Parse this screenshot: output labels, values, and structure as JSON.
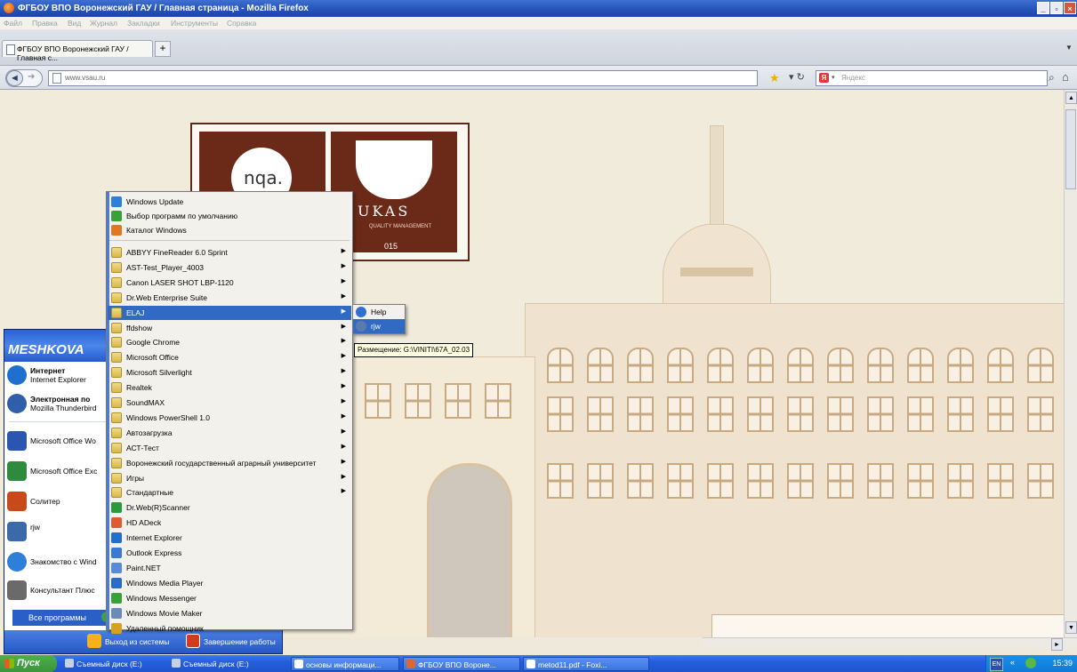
{
  "window": {
    "title": "ФГБОУ ВПО Воронежский ГАУ / Главная страница - Mozilla Firefox",
    "minimize": "_",
    "maximize": "▫",
    "close": "×"
  },
  "menubar": [
    "Файл",
    "Правка",
    "Вид",
    "Журнал",
    "Закладки",
    "Инструменты",
    "Справка"
  ],
  "tabs": [
    {
      "label": "ФГБОУ ВПО Воронежский ГАУ / Главная с..."
    }
  ],
  "new_tab": "+",
  "navbar": {
    "url": "www.vsau.ru",
    "search_placeholder": "Яндекс",
    "search_engine": "Я"
  },
  "logos": {
    "nqa": "nqa.",
    "ukas": "UKAS",
    "ukas_sub": "QUALITY MANAGEMENT",
    "ukas_number": "015"
  },
  "start_menu": {
    "user": "MESHKOVA",
    "pinned": [
      {
        "title": "Интернет",
        "subtitle": "Internet Explorer",
        "icon": "internet-explorer-icon",
        "color": "#1e6fd0"
      },
      {
        "title": "Электронная по",
        "subtitle": "Mozilla Thunderbird",
        "icon": "thunderbird-icon",
        "color": "#2f5fa8"
      }
    ],
    "recent": [
      {
        "label": "Microsoft Office Wo",
        "icon": "word-icon",
        "color": "#2a55b0"
      },
      {
        "label": "Microsoft Office Exc",
        "icon": "excel-icon",
        "color": "#2e8b3e"
      },
      {
        "label": "Солитер",
        "icon": "solitaire-icon",
        "color": "#c84a1a"
      },
      {
        "label": "rjw",
        "icon": "rjw-icon",
        "color": "#3b6aa8"
      },
      {
        "label": "Знакомство с Wind",
        "icon": "windows-tour-icon",
        "color": "#2e7fd8"
      },
      {
        "label": "Консультант Плюс",
        "icon": "consultant-icon",
        "color": "#6a6a6a"
      }
    ],
    "all_programs": "Все программы",
    "log_off": "Выход из системы",
    "shut_down": "Завершение работы"
  },
  "programs_menu": {
    "top": [
      {
        "label": "Windows Update",
        "icon": "windows-update-icon",
        "color": "#2e7fd8"
      },
      {
        "label": "Выбор программ по умолчанию",
        "icon": "default-programs-icon",
        "color": "#3aa03a"
      },
      {
        "label": "Каталог Windows",
        "icon": "windows-catalog-icon",
        "color": "#e07820"
      }
    ],
    "items": [
      {
        "label": "ABBYY FineReader 6.0 Sprint",
        "folder": true,
        "arrow": true
      },
      {
        "label": "AST-Test_Player_4003",
        "folder": true,
        "arrow": true
      },
      {
        "label": "Canon LASER SHOT LBP-1120",
        "folder": true,
        "arrow": true
      },
      {
        "label": "Dr.Web Enterprise Suite",
        "folder": true,
        "arrow": true
      },
      {
        "label": "ELAJ",
        "folder": true,
        "arrow": true,
        "highlight": true
      },
      {
        "label": "ffdshow",
        "folder": true,
        "arrow": true
      },
      {
        "label": "Google Chrome",
        "folder": true,
        "arrow": true
      },
      {
        "label": "Microsoft Office",
        "folder": true,
        "arrow": true
      },
      {
        "label": "Microsoft Silverlight",
        "folder": true,
        "arrow": true
      },
      {
        "label": "Realtek",
        "folder": true,
        "arrow": true
      },
      {
        "label": "SoundMAX",
        "folder": true,
        "arrow": true
      },
      {
        "label": "Windows PowerShell 1.0",
        "folder": true,
        "arrow": true
      },
      {
        "label": "Автозагрузка",
        "folder": true,
        "arrow": true
      },
      {
        "label": "АСТ-Тест",
        "folder": true,
        "arrow": true
      },
      {
        "label": "Воронежский государственный аграрный университет",
        "folder": true,
        "arrow": true
      },
      {
        "label": "Игры",
        "folder": true,
        "arrow": true
      },
      {
        "label": "Стандартные",
        "folder": true,
        "arrow": true
      },
      {
        "label": "Dr.Web(R)Scanner",
        "folder": false,
        "arrow": false,
        "color": "#2a9a3a"
      },
      {
        "label": "HD ADeck",
        "folder": false,
        "arrow": false,
        "color": "#e05a30"
      },
      {
        "label": "Internet Explorer",
        "folder": false,
        "arrow": false,
        "color": "#1e6fd0"
      },
      {
        "label": "Outlook Express",
        "folder": false,
        "arrow": false,
        "color": "#3a7ad0"
      },
      {
        "label": "Paint.NET",
        "folder": false,
        "arrow": false,
        "color": "#5a8ad8"
      },
      {
        "label": "Windows Media Player",
        "folder": false,
        "arrow": false,
        "color": "#2a6ac8"
      },
      {
        "label": "Windows Messenger",
        "folder": false,
        "arrow": false,
        "color": "#3aa03a"
      },
      {
        "label": "Windows Movie Maker",
        "folder": false,
        "arrow": false,
        "color": "#6a8ab8"
      },
      {
        "label": "Удаленный помощник",
        "folder": false,
        "arrow": false,
        "color": "#d8a020"
      }
    ]
  },
  "elaj_menu": [
    {
      "label": "Help",
      "icon": "help-icon",
      "color": "#2e6fd0"
    },
    {
      "label": "rjw",
      "icon": "rjw-icon",
      "color": "#5a7ab0",
      "highlight": true
    }
  ],
  "tooltip": "Размещение: G:\\VINITI\\67A_02.03",
  "taskbar": {
    "start": "Пуск",
    "buttons": [
      {
        "label": "Съемный диск (E:)",
        "plain": true,
        "color": "#c8d0e0"
      },
      {
        "label": "Съемный диск (E:)",
        "plain": true,
        "color": "#c8d0e0"
      },
      {
        "label": "основы информаци...",
        "plain": false,
        "color": "#ffffff"
      },
      {
        "label": "ФГБОУ ВПО Вороне...",
        "plain": false,
        "color": "#e0682a"
      },
      {
        "label": "metod11.pdf - Foxi...",
        "plain": false,
        "color": "#ffffff"
      }
    ],
    "lang": "EN",
    "chevron": "«",
    "clock": "15:39"
  }
}
